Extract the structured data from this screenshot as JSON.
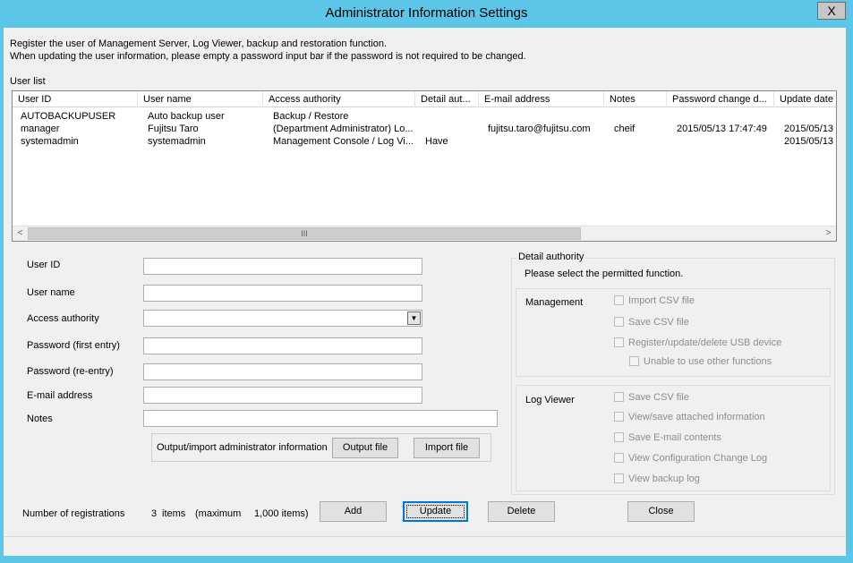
{
  "window": {
    "title": "Administrator Information Settings",
    "close_glyph": "X"
  },
  "intro": {
    "line1": "Register the user of Management Server, Log Viewer, backup and restoration function.",
    "line2": "When updating the user information, please empty a password input bar if the password is not required to be changed."
  },
  "user_list": {
    "label": "User list",
    "columns": [
      "User ID",
      "User name",
      "Access authority",
      "Detail aut...",
      "E-mail address",
      "Notes",
      "Password change d...",
      "Update date"
    ],
    "rows": [
      [
        "AUTOBACKUPUSER",
        "Auto backup user",
        "Backup / Restore",
        "",
        "",
        "",
        "",
        ""
      ],
      [
        "manager",
        "Fujitsu Taro",
        "(Department Administrator) Lo...",
        "",
        "fujitsu.taro@fujitsu.com",
        "cheif",
        "2015/05/13 17:47:49",
        "2015/05/13"
      ],
      [
        "systemadmin",
        "systemadmin",
        "Management Console / Log Vi...",
        "Have",
        "",
        "",
        "",
        "2015/05/13"
      ]
    ],
    "scroll_left": "<",
    "scroll_right": ">",
    "scroll_thumb": "III"
  },
  "form": {
    "user_id_label": "User ID",
    "user_name_label": "User name",
    "access_authority_label": "Access authority",
    "password_first_label": "Password (first entry)",
    "password_re_label": "Password (re-entry)",
    "email_label": "E-mail address",
    "notes_label": "Notes",
    "user_id_value": "",
    "user_name_value": "",
    "access_authority_value": "",
    "password_first_value": "",
    "password_re_value": "",
    "email_value": "",
    "notes_value": "",
    "combo_arrow": "▼"
  },
  "io": {
    "label": "Output/import administrator information",
    "output_button": "Output file",
    "import_button": "Import file"
  },
  "detail_authority": {
    "caption": "Detail authority",
    "instruction": "Please select the permitted function.",
    "management": {
      "label": "Management",
      "items": [
        "Import CSV file",
        "Save CSV file",
        "Register/update/delete USB device",
        "Unable to use other functions"
      ]
    },
    "log_viewer": {
      "label": "Log Viewer",
      "items": [
        "Save CSV file",
        "View/save attached information",
        "Save E-mail contents",
        "View Configuration Change Log",
        "View backup log"
      ]
    }
  },
  "footer": {
    "registrations_label": "Number of registrations",
    "count": "3",
    "items_label": "items",
    "maximum_label": "(maximum",
    "maximum_value": "1,000 items)",
    "add_button": "Add",
    "update_button": "Update",
    "delete_button": "Delete",
    "close_button": "Close"
  }
}
